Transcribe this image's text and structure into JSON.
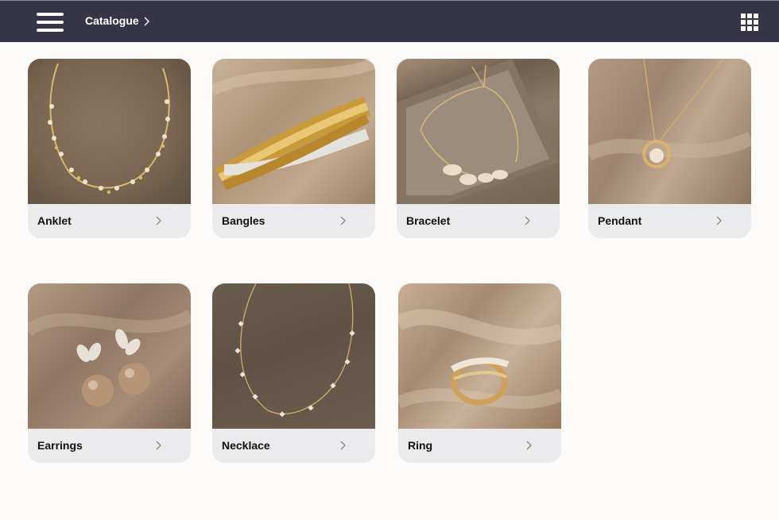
{
  "header": {
    "menu_icon": "hamburger-menu-icon",
    "breadcrumb": "Catalogue",
    "breadcrumb_icon": "chevron-right-icon",
    "grid_icon": "apps-grid-icon",
    "background": "#363547"
  },
  "catalogue": {
    "items": [
      {
        "label": "Anklet",
        "icon": "chevron-right-icon"
      },
      {
        "label": "Bangles",
        "icon": "chevron-right-icon"
      },
      {
        "label": "Bracelet",
        "icon": "chevron-right-icon"
      },
      {
        "label": "Pendant",
        "icon": "chevron-right-icon"
      },
      {
        "label": "Earrings",
        "icon": "chevron-right-icon"
      },
      {
        "label": "Necklace",
        "icon": "chevron-right-icon"
      },
      {
        "label": "Ring",
        "icon": "chevron-right-icon"
      }
    ]
  },
  "colors": {
    "page_background": "#fcfbfa",
    "card_footer": "#ebebed",
    "gold": "#c9a35c"
  }
}
